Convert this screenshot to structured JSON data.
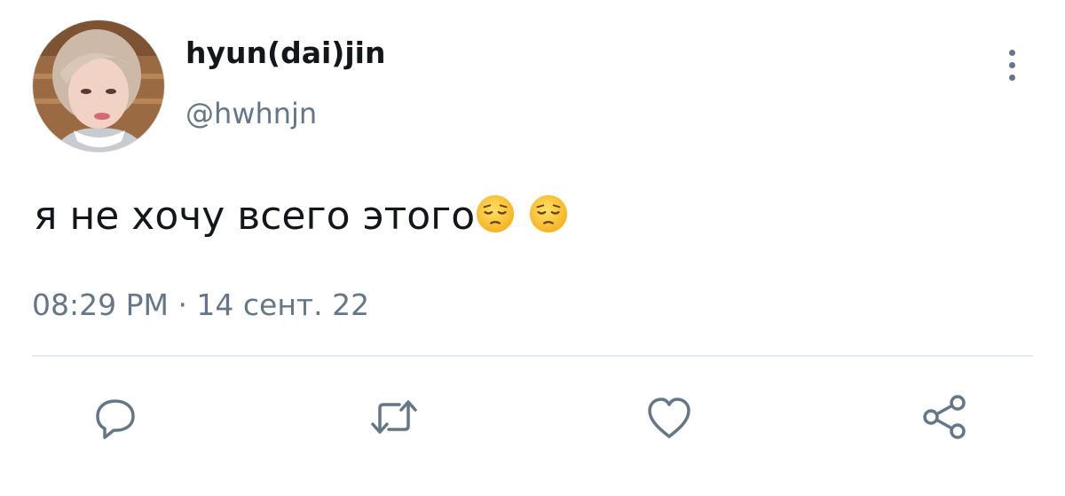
{
  "tweet": {
    "display_name": "hyun(dai)jin",
    "handle": "@hwhnjn",
    "text": "я не хочу всего этого",
    "emojis": [
      "pensive-face-emoji",
      "pensive-face-emoji"
    ],
    "timestamp": "08:29 PM · 14 сент. 22"
  },
  "actions": [
    {
      "name": "reply",
      "icon": "reply-icon"
    },
    {
      "name": "retweet",
      "icon": "retweet-icon"
    },
    {
      "name": "like",
      "icon": "heart-icon"
    },
    {
      "name": "share",
      "icon": "share-icon"
    }
  ],
  "colors": {
    "text": "#14171a",
    "secondary": "#657786",
    "divider": "#e6ecf0",
    "background": "#ffffff"
  }
}
